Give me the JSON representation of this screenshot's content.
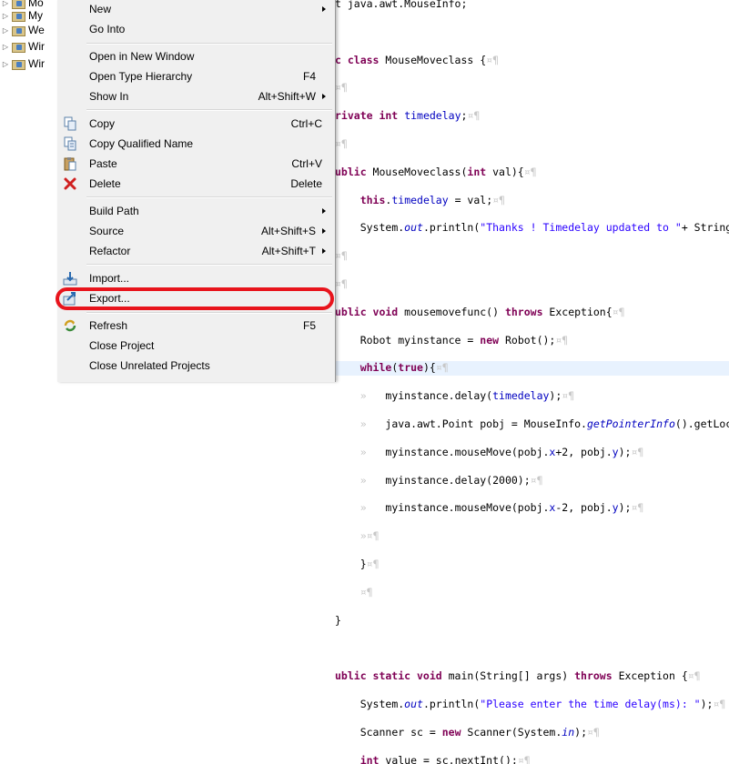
{
  "tree": {
    "items": [
      {
        "label": "Mo"
      },
      {
        "label": "My"
      },
      {
        "label": "We"
      },
      {
        "label": "Wir"
      },
      {
        "label": "Wir"
      }
    ]
  },
  "menu": {
    "items": {
      "new": {
        "label": "New"
      },
      "go_into": {
        "label": "Go Into"
      },
      "open_window": {
        "label": "Open in New Window"
      },
      "open_type_hierarchy": {
        "label": "Open Type Hierarchy",
        "shortcut": "F4"
      },
      "show_in": {
        "label": "Show In",
        "shortcut": "Alt+Shift+W"
      },
      "copy": {
        "label": "Copy",
        "shortcut": "Ctrl+C"
      },
      "copy_qualified": {
        "label": "Copy Qualified Name"
      },
      "paste": {
        "label": "Paste",
        "shortcut": "Ctrl+V"
      },
      "delete": {
        "label": "Delete",
        "shortcut": "Delete"
      },
      "build_path": {
        "label": "Build Path"
      },
      "source": {
        "label": "Source",
        "shortcut": "Alt+Shift+S"
      },
      "refactor": {
        "label": "Refactor",
        "shortcut": "Alt+Shift+T"
      },
      "import": {
        "label": "Import..."
      },
      "export": {
        "label": "Export..."
      },
      "refresh": {
        "label": "Refresh",
        "shortcut": "F5"
      },
      "close_project": {
        "label": "Close Project"
      },
      "close_unrelated": {
        "label": "Close Unrelated Projects"
      }
    }
  },
  "code": {
    "l0": {
      "a": "t java.awt.MouseInfo;"
    },
    "l2": {
      "kw": "c class",
      "rest": " MouseMoveclass {"
    },
    "l4": {
      "kw": "rivate int",
      "rest": " ",
      "fld": "timedelay",
      "end": ";"
    },
    "l6": {
      "kw": "ublic",
      "rest": " MouseMoveclass(",
      "kw2": "int",
      "end": " val){"
    },
    "l7": {
      "kw": "this",
      "rest": ".",
      "fld": "timedelay",
      "end": " = val;"
    },
    "l8": {
      "a": "System.",
      "st": "out",
      "b": ".println(",
      "str": "\"Thanks ! Timedelay updated to \"",
      "c": "+ String"
    },
    "l11": {
      "kw": "ublic void",
      "rest": " mousemovefunc() ",
      "kw2": "throws",
      "end": " Exception{"
    },
    "l12": {
      "a": "Robot myinstance = ",
      "kw": "new",
      "b": " Robot();"
    },
    "l13": {
      "kw": "while",
      "a": "(",
      "kw2": "true",
      "b": "){"
    },
    "l14": {
      "a": "myinstance.delay(",
      "fld": "timedelay",
      "b": ");"
    },
    "l15": {
      "a": "java.awt.Point pobj = MouseInfo.",
      "st": "getPointerInfo",
      "b": "().getLoc"
    },
    "l16": {
      "a": "myinstance.mouseMove(pobj.",
      "fld": "x",
      "b": "+2, pobj.",
      "fld2": "y",
      "c": ");"
    },
    "l17": {
      "a": "myinstance.delay(2000);"
    },
    "l18": {
      "a": "myinstance.mouseMove(pobj.",
      "fld": "x",
      "b": "-2, pobj.",
      "fld2": "y",
      "c": ");"
    },
    "l19": {
      "a": "}"
    },
    "l20": {
      "a": "}"
    },
    "l23": {
      "kw": "ublic static void",
      "rest": " main(String[] args) ",
      "kw2": "throws",
      "end": " Exception {"
    },
    "l24": {
      "a": "System.",
      "st": "out",
      "b": ".println(",
      "str": "\"Please enter the time delay(ms): \"",
      "c": ");"
    },
    "l25": {
      "a": "Scanner sc = ",
      "kw": "new",
      "b": " Scanner(System.",
      "st": "in",
      "c": ");"
    },
    "l26": {
      "kw": "int",
      "a": " value = sc.nextInt();"
    }
  },
  "colors": {
    "highlight_ring": "#e8141c",
    "menu_bg": "#f0f0f0"
  }
}
